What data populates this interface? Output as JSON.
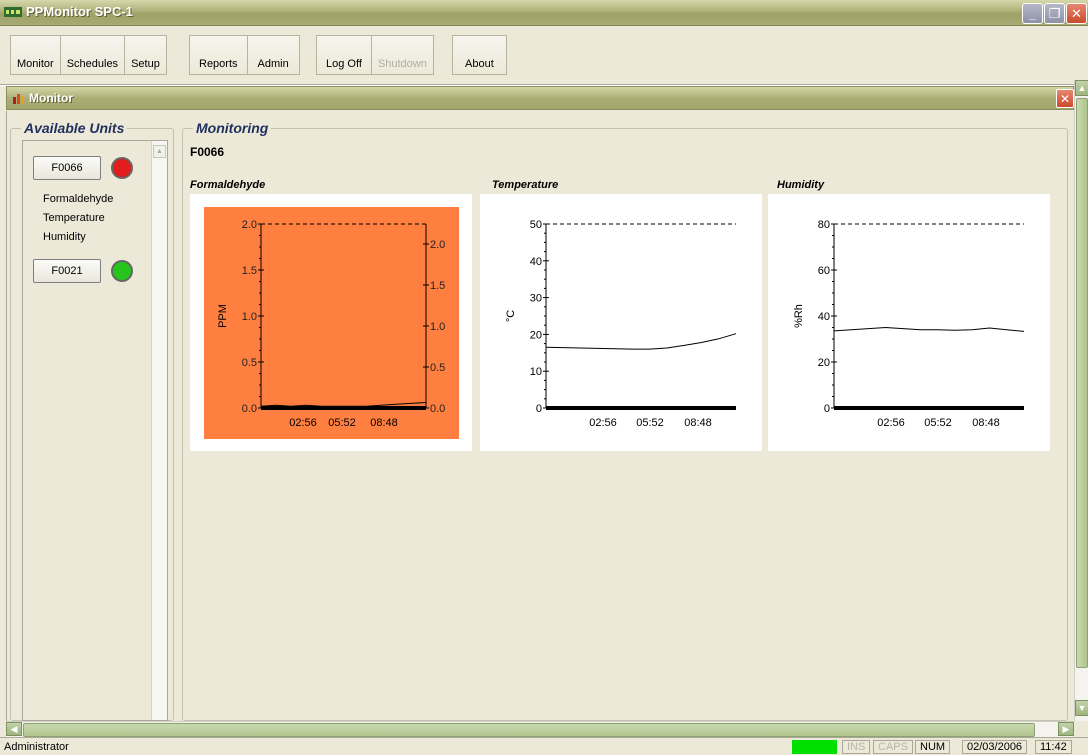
{
  "app": {
    "title": "PPMonitor SPC-1",
    "icon": "ppm-logo-icon"
  },
  "toolbar": {
    "groups": [
      [
        "Monitor",
        "Schedules",
        "Setup"
      ],
      [
        "Reports",
        "Admin"
      ],
      [
        "Log Off",
        "Shutdown"
      ],
      [
        "About"
      ]
    ],
    "monitor": "Monitor",
    "schedules": "Schedules",
    "setup": "Setup",
    "reports": "Reports",
    "admin": "Admin",
    "logoff": "Log Off",
    "shutdown": "Shutdown",
    "about": "About"
  },
  "child": {
    "title": "Monitor"
  },
  "units": {
    "legend": "Available Units",
    "items": [
      {
        "name": "F0066",
        "status_color": "#e11d1d",
        "sensors": [
          "Formaldehyde",
          "Temperature",
          "Humidity"
        ]
      },
      {
        "name": "F0021",
        "status_color": "#26c41c",
        "sensors": []
      }
    ]
  },
  "monitoring": {
    "legend": "Monitoring",
    "unit": "F0066",
    "charts": [
      {
        "title": "Formaldehyde",
        "ylabel": "PPM"
      },
      {
        "title": "Temperature",
        "ylabel": "°C"
      },
      {
        "title": "Humidity",
        "ylabel": "%Rh"
      }
    ]
  },
  "chart_data": [
    {
      "type": "line",
      "title": "Formaldehyde",
      "ylabel": "PPM",
      "ylim": [
        0,
        2.0
      ],
      "yticks": [
        "0.0",
        "0.5",
        "1.0",
        "1.5",
        "2.0"
      ],
      "y2ticks": [
        "0.0",
        "0.5",
        "1.0",
        "1.5",
        "2.0"
      ],
      "xticks": [
        "02:56",
        "05:52",
        "08:48"
      ],
      "limit": 2.0,
      "background": "#ff7f40",
      "x": [
        0,
        1,
        2,
        3,
        4,
        5,
        6,
        7,
        8,
        9,
        10,
        11
      ],
      "values": [
        0.02,
        0.03,
        0.02,
        0.03,
        0.02,
        0.02,
        0.02,
        0.02,
        0.03,
        0.04,
        0.05,
        0.06
      ]
    },
    {
      "type": "line",
      "title": "Temperature",
      "ylabel": "°C",
      "ylim": [
        0,
        50
      ],
      "yticks": [
        "0",
        "10",
        "20",
        "30",
        "40",
        "50"
      ],
      "xticks": [
        "02:56",
        "05:52",
        "08:48"
      ],
      "limit": 50,
      "background": "#ffffff",
      "x": [
        0,
        1,
        2,
        3,
        4,
        5,
        6,
        7,
        8,
        9,
        10,
        11
      ],
      "values": [
        16.5,
        16.4,
        16.3,
        16.2,
        16.1,
        16.0,
        16.0,
        16.3,
        17.0,
        17.8,
        18.8,
        20.2
      ]
    },
    {
      "type": "line",
      "title": "Humidity",
      "ylabel": "%Rh",
      "ylim": [
        0,
        80
      ],
      "yticks": [
        "0",
        "20",
        "40",
        "60",
        "80"
      ],
      "xticks": [
        "02:56",
        "05:52",
        "08:48"
      ],
      "limit": 80,
      "background": "#ffffff",
      "x": [
        0,
        1,
        2,
        3,
        4,
        5,
        6,
        7,
        8,
        9,
        10,
        11
      ],
      "values": [
        33.5,
        34.0,
        34.5,
        35.0,
        34.5,
        34.0,
        34.0,
        33.8,
        34.0,
        34.8,
        34.0,
        33.3
      ]
    }
  ],
  "status": {
    "user": "Administrator",
    "indicator_color": "#00e000",
    "ins": "INS",
    "caps": "CAPS",
    "num": "NUM",
    "date": "02/03/2006",
    "time": "11:42"
  }
}
